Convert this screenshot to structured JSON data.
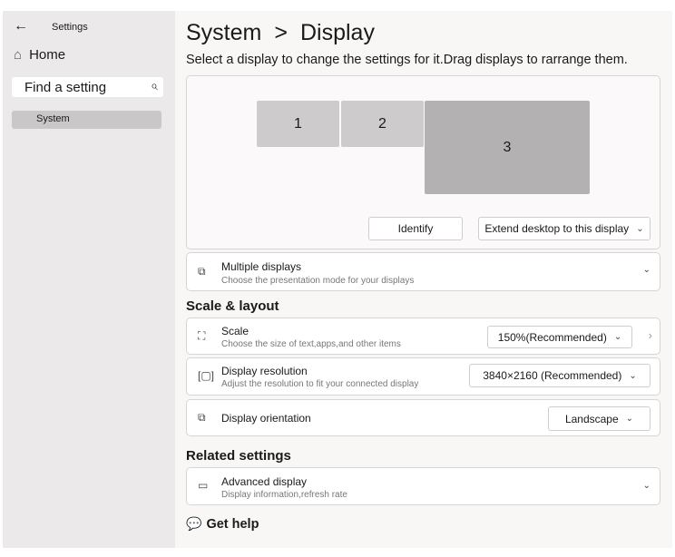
{
  "sidebar": {
    "back_icon": "←",
    "title": "Settings",
    "home": "Home",
    "home_icon": "⌂",
    "search_placeholder": "Find a setting",
    "search_icon": "⌕",
    "items": [
      {
        "label": "System"
      }
    ]
  },
  "header": {
    "breadcrumb_parent": "System",
    "separator": ">",
    "breadcrumb_current": "Display",
    "subtitle": "Select a display to change the settings for it.Drag displays to rarrange them."
  },
  "displays": {
    "monitors": [
      "1",
      "2",
      "3"
    ],
    "identify": "Identify",
    "mode": "Extend desktop to this display"
  },
  "multiple": {
    "title": "Multiple displays",
    "desc": "Choose the presentation mode for your displays"
  },
  "scale_layout": {
    "heading": "Scale & layout",
    "scale": {
      "title": "Scale",
      "desc": "Choose the size of text,apps,and other items",
      "value": "150%(Recommended)"
    },
    "resolution": {
      "title": "Display resolution",
      "desc": "Adjust the resolution to fit your connected display",
      "value": "3840×2160 (Recommended)"
    },
    "orientation": {
      "title": "Display orientation",
      "value": "Landscape"
    }
  },
  "related": {
    "heading": "Related settings",
    "advanced": {
      "title": "Advanced display",
      "desc": "Display information,refresh rate"
    }
  },
  "help": {
    "label": "Get help"
  }
}
